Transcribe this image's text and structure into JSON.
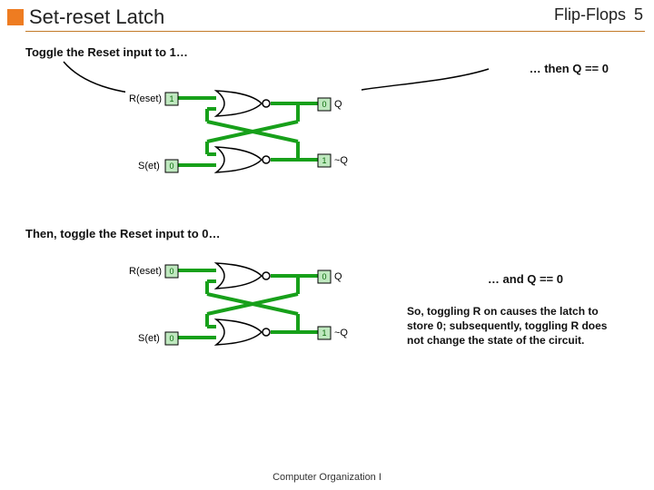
{
  "header": {
    "title": "Set-reset Latch",
    "section": "Flip-Flops",
    "page_number": "5"
  },
  "steps": {
    "s1_text": "Toggle the Reset input to 1…",
    "s1_result": "… then Q == 0",
    "s2_text": "Then, toggle the Reset input to 0…",
    "s2_result": "… and Q == 0",
    "explanation": "So, toggling R on causes the latch to store 0; subsequently, toggling R does not change the state of the circuit."
  },
  "diagram": {
    "input_reset": "R(eset)",
    "input_set": "S(et)",
    "output_q": "Q",
    "output_nq": "~Q",
    "pin_values_top": {
      "R": "1",
      "S": "0",
      "Q": "0",
      "nQ": "1"
    },
    "pin_values_bottom": {
      "R": "0",
      "S": "0",
      "Q": "0",
      "nQ": "1"
    }
  },
  "footer": "Computer Organization I"
}
